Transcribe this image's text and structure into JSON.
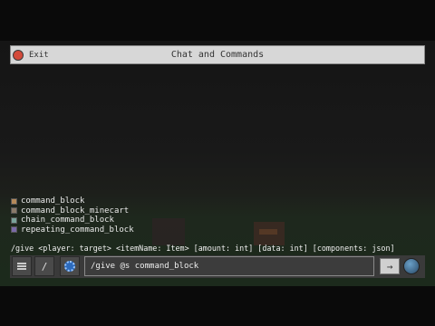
{
  "header": {
    "exit_label": "Exit",
    "title": "Chat and Commands"
  },
  "suggestions": [
    {
      "label": "command_block",
      "icon": "command-block-icon"
    },
    {
      "label": "command_block_minecart",
      "icon": "minecart-icon"
    },
    {
      "label": "chain_command_block",
      "icon": "chain-command-block-icon"
    },
    {
      "label": "repeating_command_block",
      "icon": "repeating-command-block-icon"
    }
  ],
  "syntax_hint": "/give <player: target> <itemName: Item> [amount: int] [data: int] [components: json]",
  "input": {
    "value": "/give @s command_block"
  },
  "buttons": {
    "slash_label": "/",
    "send_label": "→"
  },
  "colors": {
    "exit_icon": "#d34a3a",
    "title_bar": "#d7d7d7",
    "settings_icon": "#2d6bbd"
  }
}
